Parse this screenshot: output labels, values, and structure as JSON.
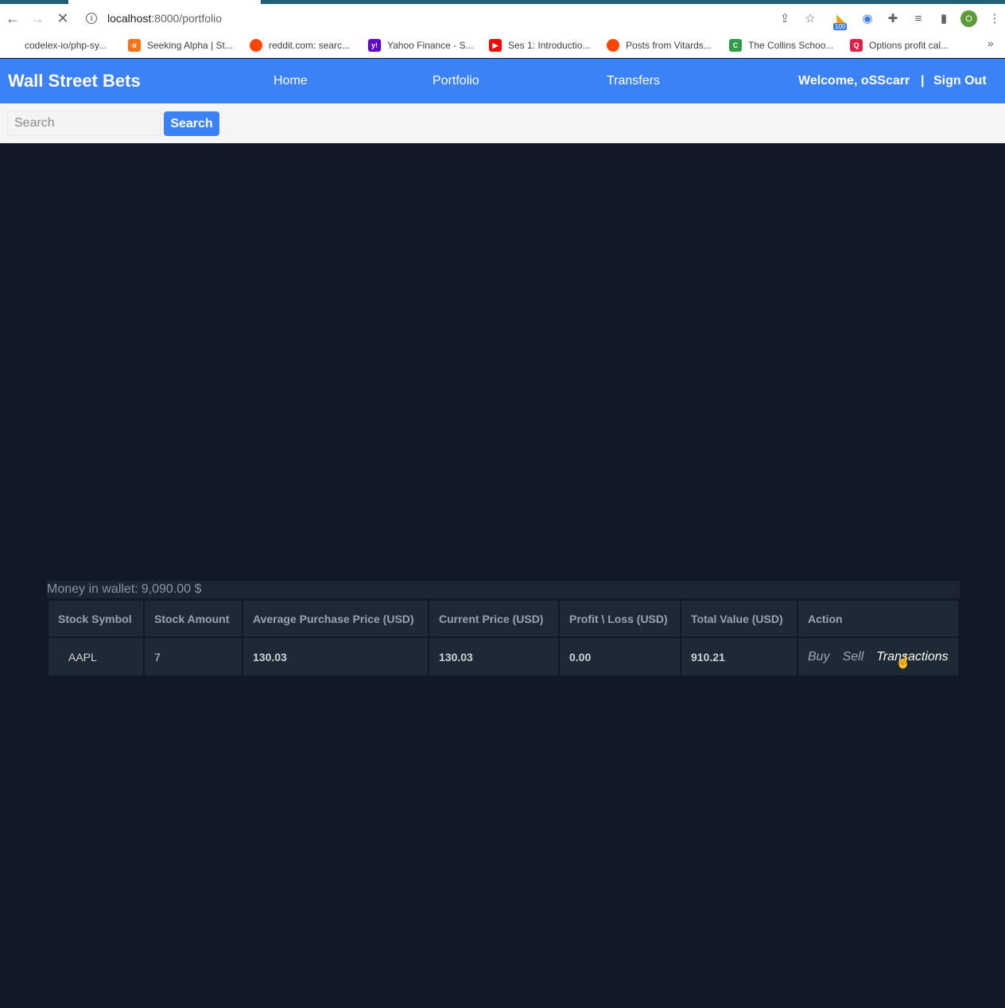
{
  "browser": {
    "url_host": "localhost",
    "url_path": ":8000/portfolio",
    "profile_initial": "O",
    "extension_badge": "100",
    "bookmarks": [
      {
        "label": "codelex-io/php-sy...",
        "color": "#24292e",
        "glyph": ""
      },
      {
        "label": "Seeking Alpha | St...",
        "color": "#f97316",
        "glyph": "α"
      },
      {
        "label": "reddit.com: searc...",
        "color": "#ff4500",
        "glyph": "●"
      },
      {
        "label": "Yahoo Finance - S...",
        "color": "#6001d2",
        "glyph": "y!"
      },
      {
        "label": "Ses 1: Introductio...",
        "color": "#ff0000",
        "glyph": "▶"
      },
      {
        "label": "Posts from Vitards...",
        "color": "#ff4500",
        "glyph": "●"
      },
      {
        "label": "The Collins Schoo...",
        "color": "#2e9c48",
        "glyph": "C"
      },
      {
        "label": "Options profit cal...",
        "color": "#e11d48",
        "glyph": "Q"
      }
    ]
  },
  "header": {
    "brand": "Wall Street Bets",
    "nav": [
      "Home",
      "Portfolio",
      "Transfers"
    ],
    "welcome": "Welcome, oSScarr",
    "divider": "|",
    "signout": "Sign Out"
  },
  "search": {
    "placeholder": "Search",
    "button": "Search"
  },
  "wallet": {
    "label": "Money in wallet:",
    "amount": "9,090.00 $"
  },
  "table": {
    "headers": [
      "Stock Symbol",
      "Stock Amount",
      "Average Purchase Price (USD)",
      "Current Price (USD)",
      "Profit \\ Loss (USD)",
      "Total Value (USD)",
      "Action"
    ],
    "rows": [
      {
        "symbol": "AAPL",
        "amount": "7",
        "avg_price": "130.03",
        "current_price": "130.03",
        "profit_loss": "0.00",
        "total_value": "910.21",
        "actions": [
          "Buy",
          "Sell",
          "Transactions"
        ]
      }
    ]
  }
}
